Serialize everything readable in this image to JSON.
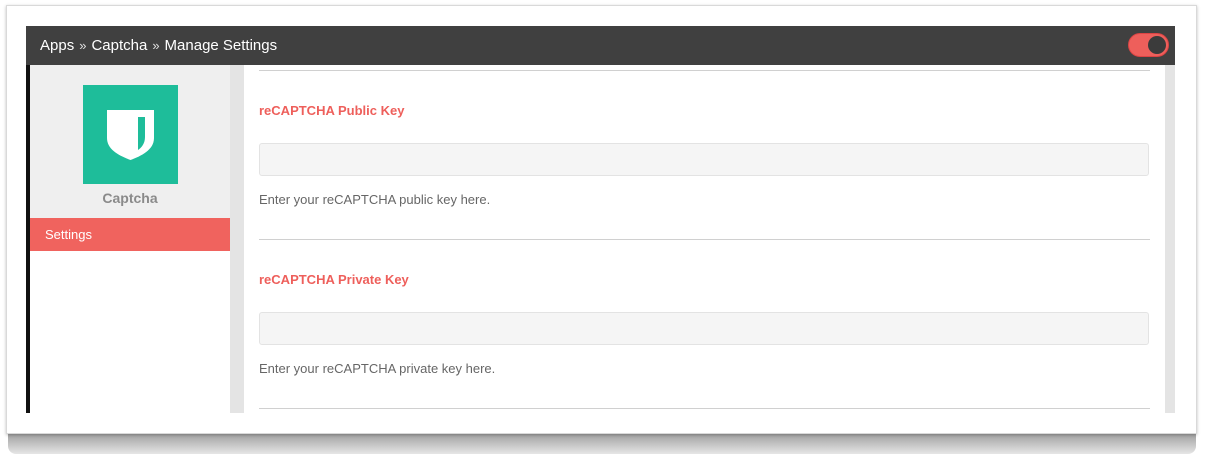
{
  "breadcrumb": {
    "items": [
      "Apps",
      "Captcha",
      "Manage Settings"
    ],
    "separator": "»"
  },
  "toggle": {
    "state": "on",
    "color": "#ee5f5b"
  },
  "app": {
    "name": "Captcha",
    "logo_icon": "shield-icon",
    "logo_color": "#1ebd9a"
  },
  "sidebar": {
    "items": [
      {
        "label": "Settings",
        "active": true
      }
    ]
  },
  "fields": [
    {
      "label": "reCAPTCHA Public Key",
      "value": "",
      "help": "Enter your reCAPTCHA public key here."
    },
    {
      "label": "reCAPTCHA Private Key",
      "value": "",
      "help": "Enter your reCAPTCHA private key here."
    }
  ],
  "colors": {
    "accent": "#ee5f5b",
    "topbar": "#404040"
  }
}
